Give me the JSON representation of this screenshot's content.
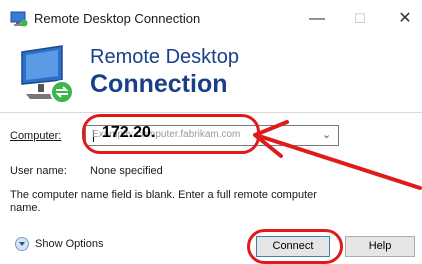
{
  "window": {
    "title": "Remote Desktop Connection",
    "minimize_glyph": "—",
    "maximize_glyph": "☐",
    "close_glyph": "✕",
    "icon": "remote-desktop-icon"
  },
  "banner": {
    "line1": "Remote Desktop",
    "line2": "Connection",
    "logo": "remote-desktop-logo"
  },
  "form": {
    "computer_label": "Computer:",
    "computer_placeholder": "Example: computer.fabrikam.com",
    "computer_typed": "172.20.",
    "dropdown_glyph": "⌄",
    "username_label": "User name:",
    "username_value": "None specified",
    "message": "The computer name field is blank. Enter a full remote computer name."
  },
  "footer": {
    "show_options_label": "Show Options",
    "connect_label": "Connect",
    "help_label": "Help"
  },
  "annotations": {
    "color": "#e01b1b"
  }
}
